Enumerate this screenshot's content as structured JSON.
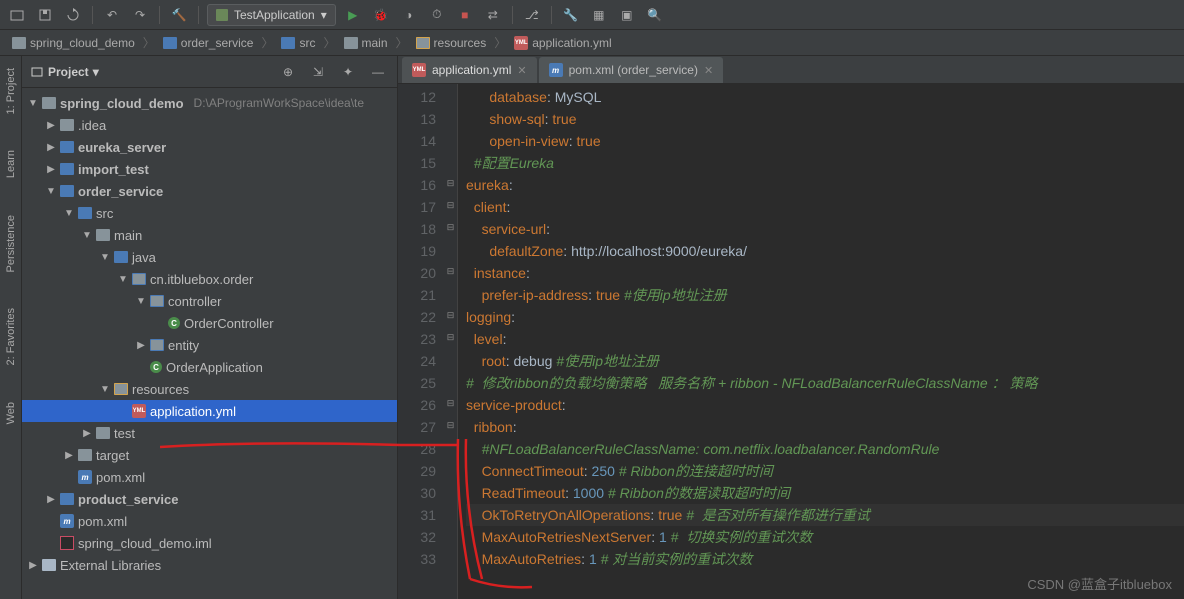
{
  "toolbar": {
    "run_config": "TestApplication"
  },
  "breadcrumb": [
    {
      "icon": "folder",
      "label": "spring_cloud_demo"
    },
    {
      "icon": "folder-mod",
      "label": "order_service"
    },
    {
      "icon": "folder-mod",
      "label": "src"
    },
    {
      "icon": "folder",
      "label": "main"
    },
    {
      "icon": "folder-res",
      "label": "resources"
    },
    {
      "icon": "yml",
      "label": "application.yml"
    }
  ],
  "rails": [
    "1: Project",
    "Learn",
    "Persistence",
    "2: Favorites",
    "Web"
  ],
  "panel": {
    "title": "Project"
  },
  "tree": [
    {
      "d": 0,
      "arrow": "▼",
      "icon": "folder",
      "name": "spring_cloud_demo",
      "dim": "D:\\AProgramWorkSpace\\idea\\te",
      "bold": true
    },
    {
      "d": 1,
      "arrow": "▶",
      "icon": "folder",
      "name": ".idea"
    },
    {
      "d": 1,
      "arrow": "▶",
      "icon": "folder-mod",
      "name": "eureka_server",
      "bold": true
    },
    {
      "d": 1,
      "arrow": "▶",
      "icon": "folder-mod",
      "name": "import_test",
      "bold": true
    },
    {
      "d": 1,
      "arrow": "▼",
      "icon": "folder-mod",
      "name": "order_service",
      "bold": true
    },
    {
      "d": 2,
      "arrow": "▼",
      "icon": "folder-mod",
      "name": "src"
    },
    {
      "d": 3,
      "arrow": "▼",
      "icon": "folder",
      "name": "main"
    },
    {
      "d": 4,
      "arrow": "▼",
      "icon": "folder-mod",
      "name": "java"
    },
    {
      "d": 5,
      "arrow": "▼",
      "icon": "folder-pkg",
      "name": "cn.itbluebox.order"
    },
    {
      "d": 6,
      "arrow": "▼",
      "icon": "folder-pkg",
      "name": "controller"
    },
    {
      "d": 7,
      "arrow": "",
      "icon": "class",
      "name": "OrderController"
    },
    {
      "d": 6,
      "arrow": "▶",
      "icon": "folder-pkg",
      "name": "entity"
    },
    {
      "d": 6,
      "arrow": "",
      "icon": "class",
      "name": "OrderApplication",
      "spring": true
    },
    {
      "d": 4,
      "arrow": "▼",
      "icon": "folder-res",
      "name": "resources"
    },
    {
      "d": 5,
      "arrow": "",
      "icon": "yml",
      "name": "application.yml",
      "sel": true
    },
    {
      "d": 3,
      "arrow": "▶",
      "icon": "folder",
      "name": "test"
    },
    {
      "d": 2,
      "arrow": "▶",
      "icon": "folder",
      "name": "target"
    },
    {
      "d": 2,
      "arrow": "",
      "icon": "xml",
      "name": "pom.xml"
    },
    {
      "d": 1,
      "arrow": "▶",
      "icon": "folder-mod",
      "name": "product_service",
      "bold": true
    },
    {
      "d": 1,
      "arrow": "",
      "icon": "xml",
      "name": "pom.xml"
    },
    {
      "d": 1,
      "arrow": "",
      "icon": "iml",
      "name": "spring_cloud_demo.iml"
    },
    {
      "d": 0,
      "arrow": "▶",
      "icon": "lib",
      "name": "External Libraries"
    }
  ],
  "tabs": [
    {
      "icon": "yml",
      "label": "application.yml",
      "active": true
    },
    {
      "icon": "xml",
      "label": "pom.xml (order_service)",
      "active": false
    }
  ],
  "editor": {
    "first_line": 12,
    "current_line": 31,
    "lines": [
      {
        "t": [
          [
            "",
            "      "
          ],
          [
            "k",
            "database"
          ],
          [
            "v",
            ": "
          ],
          [
            "v",
            "MySQL"
          ]
        ]
      },
      {
        "t": [
          [
            "",
            "      "
          ],
          [
            "k",
            "show-sql"
          ],
          [
            "v",
            ": "
          ],
          [
            "b",
            "true"
          ]
        ]
      },
      {
        "t": [
          [
            "",
            "      "
          ],
          [
            "k",
            "open-in-view"
          ],
          [
            "v",
            ": "
          ],
          [
            "b",
            "true"
          ]
        ]
      },
      {
        "t": [
          [
            "",
            "  "
          ],
          [
            "c",
            "#配置Eureka"
          ]
        ]
      },
      {
        "t": [
          [
            "k",
            "eureka"
          ],
          [
            "v",
            ":"
          ]
        ]
      },
      {
        "t": [
          [
            "",
            "  "
          ],
          [
            "k",
            "client"
          ],
          [
            "v",
            ":"
          ]
        ]
      },
      {
        "t": [
          [
            "",
            "    "
          ],
          [
            "k",
            "service-url"
          ],
          [
            "v",
            ":"
          ]
        ]
      },
      {
        "t": [
          [
            "",
            "      "
          ],
          [
            "k",
            "defaultZone"
          ],
          [
            "v",
            ": "
          ],
          [
            "v",
            "http://localhost:9000/eureka/"
          ]
        ]
      },
      {
        "t": [
          [
            "",
            "  "
          ],
          [
            "k",
            "instance"
          ],
          [
            "v",
            ":"
          ]
        ]
      },
      {
        "t": [
          [
            "",
            "    "
          ],
          [
            "k",
            "prefer-ip-address"
          ],
          [
            "v",
            ": "
          ],
          [
            "b",
            "true"
          ],
          [
            "v",
            " "
          ],
          [
            "c",
            "#使用ip地址注册"
          ]
        ]
      },
      {
        "t": [
          [
            "k",
            "logging"
          ],
          [
            "v",
            ":"
          ]
        ]
      },
      {
        "t": [
          [
            "",
            "  "
          ],
          [
            "k",
            "level"
          ],
          [
            "v",
            ":"
          ]
        ]
      },
      {
        "t": [
          [
            "",
            "    "
          ],
          [
            "k",
            "root"
          ],
          [
            "v",
            ": "
          ],
          [
            "v",
            "debug"
          ],
          [
            "v",
            " "
          ],
          [
            "c",
            "#使用ip地址注册"
          ]
        ]
      },
      {
        "t": [
          [
            "c",
            "#  修改ribbon的负载均衡策略   服务名称 + ribbon - NFLoadBalancerRuleClassName ： 策略"
          ]
        ]
      },
      {
        "t": [
          [
            "k",
            "service-product"
          ],
          [
            "v",
            ":"
          ]
        ]
      },
      {
        "t": [
          [
            "",
            "  "
          ],
          [
            "k",
            "ribbon"
          ],
          [
            "v",
            ":"
          ]
        ]
      },
      {
        "t": [
          [
            "",
            "    "
          ],
          [
            "c",
            "#NFLoadBalancerRuleClassName: com.netflix.loadbalancer.RandomRule"
          ]
        ]
      },
      {
        "t": [
          [
            "",
            "    "
          ],
          [
            "k",
            "ConnectTimeout"
          ],
          [
            "v",
            ": "
          ],
          [
            "n",
            "250"
          ],
          [
            "v",
            " "
          ],
          [
            "c",
            "# Ribbon的连接超时时间"
          ]
        ]
      },
      {
        "t": [
          [
            "",
            "    "
          ],
          [
            "k",
            "ReadTimeout"
          ],
          [
            "v",
            ": "
          ],
          [
            "n",
            "1000"
          ],
          [
            "v",
            " "
          ],
          [
            "c",
            "# Ribbon的数据读取超时时间"
          ]
        ]
      },
      {
        "t": [
          [
            "",
            "    "
          ],
          [
            "k",
            "OkToRetryOnAllOperations"
          ],
          [
            "v",
            ": "
          ],
          [
            "b",
            "true"
          ],
          [
            "v",
            " "
          ],
          [
            "c",
            "#  是否对所有操作都进行重试"
          ]
        ]
      },
      {
        "t": [
          [
            "",
            "    "
          ],
          [
            "k",
            "MaxAutoRetriesNextServer"
          ],
          [
            "v",
            ": "
          ],
          [
            "n",
            "1"
          ],
          [
            "v",
            " "
          ],
          [
            "c",
            "#  切换实例的重试次数"
          ]
        ]
      },
      {
        "t": [
          [
            "",
            "    "
          ],
          [
            "k",
            "MaxAutoRetries"
          ],
          [
            "v",
            ": "
          ],
          [
            "n",
            "1"
          ],
          [
            "v",
            " "
          ],
          [
            "c",
            "# 对当前实例的重试次数"
          ]
        ]
      }
    ]
  },
  "watermark": "CSDN @蓝盒子itbluebox"
}
